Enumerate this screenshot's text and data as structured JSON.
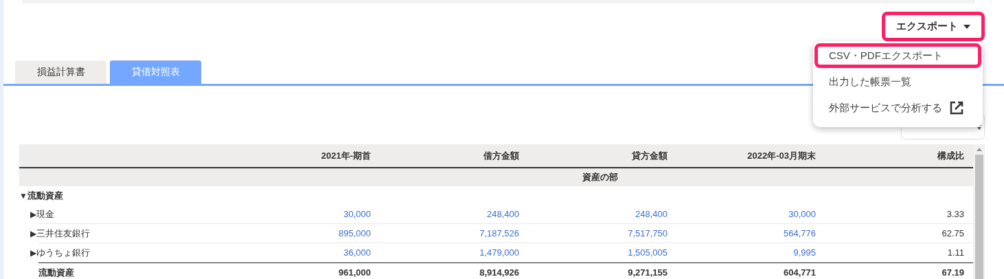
{
  "export_button": {
    "label": "エクスポート",
    "highlighted": true
  },
  "export_menu": {
    "items": [
      {
        "label": "CSV・PDFエクスポート",
        "highlighted": true,
        "external": false
      },
      {
        "label": "出力した帳票一覧",
        "highlighted": false,
        "external": false
      },
      {
        "label": "外部サービスで分析する",
        "highlighted": false,
        "external": true
      }
    ]
  },
  "tabs": [
    {
      "label": "損益計算書",
      "selected": false
    },
    {
      "label": "貸借対照表",
      "selected": true
    }
  ],
  "table": {
    "columns": [
      "2021年-期首",
      "借方金額",
      "貸方金額",
      "2022年-03月期末",
      "構成比"
    ],
    "section": "資産の部",
    "rows": [
      {
        "kind": "group",
        "toggle": "▼",
        "label": "流動資産",
        "values": []
      },
      {
        "kind": "item",
        "toggle": "▶",
        "label": "現金",
        "values": [
          "30,000",
          "248,400",
          "248,400",
          "30,000",
          "3.33"
        ]
      },
      {
        "kind": "item",
        "toggle": "▶",
        "label": "三井住友銀行",
        "values": [
          "895,000",
          "7,187,526",
          "7,517,750",
          "564,776",
          "62.75"
        ]
      },
      {
        "kind": "item",
        "toggle": "▶",
        "label": "ゆうちょ銀行",
        "values": [
          "36,000",
          "1,479,000",
          "1,505,005",
          "9,995",
          "1.11"
        ]
      },
      {
        "kind": "total",
        "label": "流動資産",
        "values": [
          "961,000",
          "8,914,926",
          "9,271,155",
          "604,771",
          "67.19"
        ]
      }
    ]
  }
}
